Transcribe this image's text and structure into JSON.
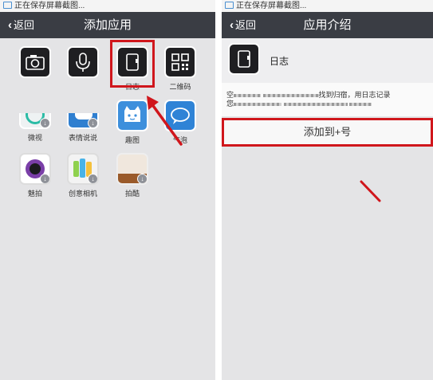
{
  "status_bar": {
    "text": "正在保存屏幕截图..."
  },
  "left": {
    "nav": {
      "back_label": "返回",
      "title": "添加应用"
    },
    "apps": [
      {
        "name": "camera",
        "label": ""
      },
      {
        "name": "voice",
        "label": ""
      },
      {
        "name": "diary",
        "label": "日志"
      },
      {
        "name": "qrcode",
        "label": "二维码"
      },
      {
        "name": "weishi",
        "label": "微视"
      },
      {
        "name": "biaoqing",
        "label": "表情说说"
      },
      {
        "name": "qutu",
        "label": "趣图"
      },
      {
        "name": "qipao",
        "label": "气泡"
      },
      {
        "name": "meipai",
        "label": "魅拍"
      },
      {
        "name": "chuangyi",
        "label": "创意相机"
      },
      {
        "name": "paiku",
        "label": "拍酷"
      }
    ]
  },
  "right": {
    "nav": {
      "back_label": "返回",
      "title": "应用介绍"
    },
    "app_name": "日志",
    "description_line1_start": "空",
    "description_line1_end": "找到归宿，用日志记录",
    "description_line2_start": "您",
    "add_button_label": "添加到+号"
  },
  "colors": {
    "nav_bg": "#3a3d44",
    "highlight": "#d0161c",
    "qutu_blue": "#3d8fdc",
    "qipao_blue": "#2f83d6"
  }
}
